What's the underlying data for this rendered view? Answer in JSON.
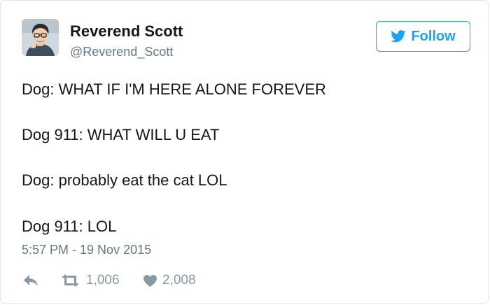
{
  "author": {
    "name": "Reverend Scott",
    "handle": "@Reverend_Scott",
    "avatar_icon": "cartoon-avatar"
  },
  "follow_button": {
    "label": "Follow",
    "icon": "twitter-bird-icon",
    "color": "#1da1f2"
  },
  "tweet": {
    "lines": [
      "Dog: WHAT IF I'M HERE ALONE FOREVER",
      "Dog 911: WHAT WILL U EAT",
      "Dog: probably eat the cat LOL",
      "Dog 911: LOL"
    ],
    "timestamp": "5:57 PM - 19 Nov 2015"
  },
  "actions": {
    "reply": {
      "icon": "reply-icon"
    },
    "retweet": {
      "icon": "retweet-icon",
      "count": "1,006"
    },
    "like": {
      "icon": "heart-icon",
      "count": "2,008"
    }
  },
  "colors": {
    "text": "#14171a",
    "secondary_text": "#657786",
    "action_gray": "#8899a6",
    "border": "#e1e8ed"
  }
}
